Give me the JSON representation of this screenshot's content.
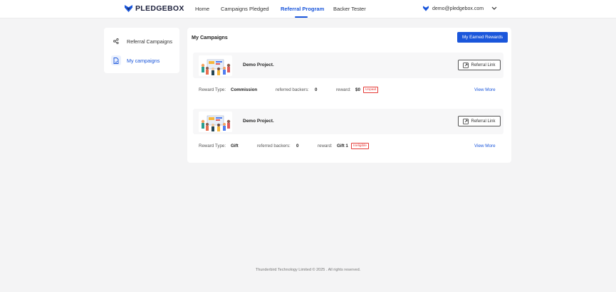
{
  "header": {
    "brand": "PLEDGEBOX",
    "nav": [
      "Home",
      "Campaigns Pledged",
      "Referral Program",
      "Backer Tester"
    ],
    "active_nav": "Referral Program",
    "user_email": "demo@pledgebox.com"
  },
  "sidebar": {
    "items": [
      {
        "label": "Referral Campaigns",
        "icon": "share-icon"
      },
      {
        "label": "My campaigns",
        "icon": "document-icon",
        "active": true
      }
    ]
  },
  "main": {
    "title": "My Campaigns",
    "earned_rewards_label": "My Earned Rewards",
    "campaigns": [
      {
        "name": "Demo Project.",
        "referral_link_label": "Referral Link",
        "reward_type_label": "Reward Type:",
        "reward_type": "Commission",
        "referred_backers_label": "referred backers:",
        "referred_backers": "0",
        "reward_label": "reward:",
        "reward": "$0",
        "status": "Unpaid",
        "view_more": "View More"
      },
      {
        "name": "Demo Project.",
        "referral_link_label": "Referral Link",
        "reward_type_label": "Reward Type:",
        "reward_type": "Gift",
        "referred_backers_label": "referred backers:",
        "referred_backers": "0",
        "reward_label": "reward:",
        "reward": "Gift 1",
        "status": "Ineligible",
        "view_more": "View More"
      }
    ]
  },
  "footer": {
    "text": "Thunderbird Technology Limited © 2025 . All rights reserved."
  },
  "colors": {
    "accent": "#1a56db",
    "danger": "#e53935",
    "background": "#f4f4f5"
  }
}
